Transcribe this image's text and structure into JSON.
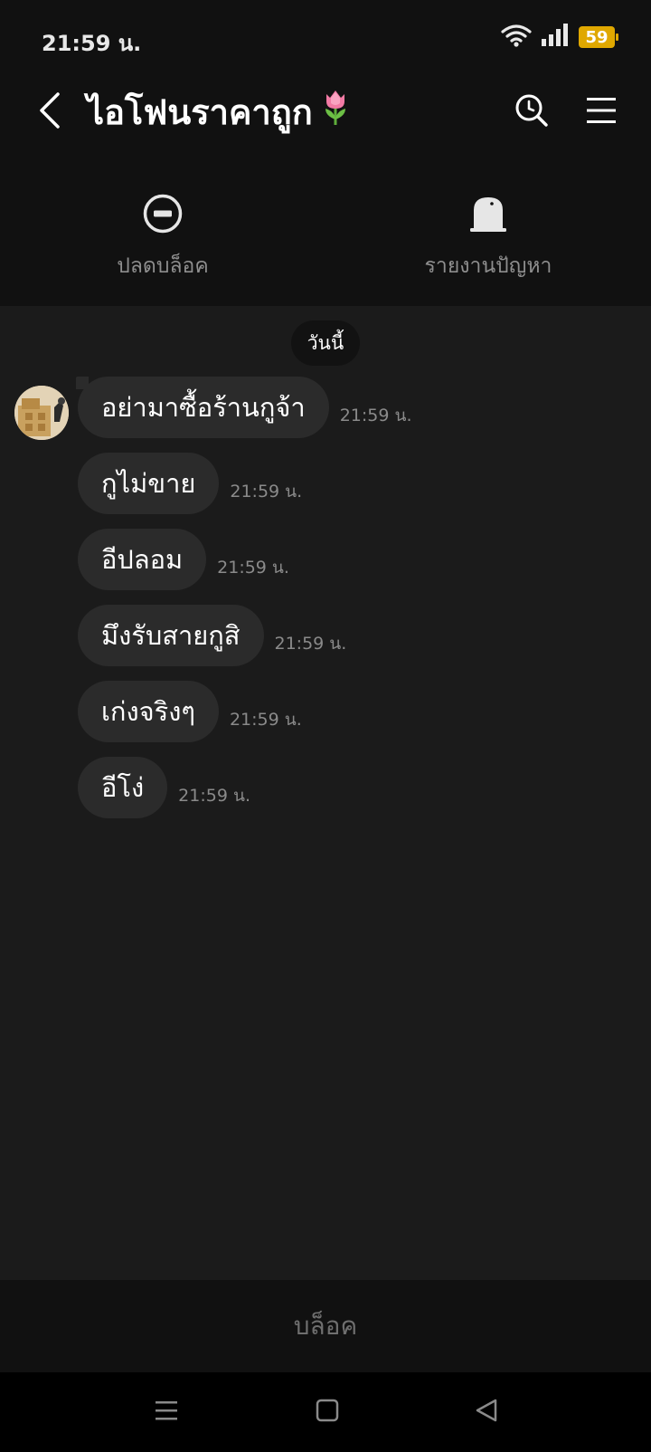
{
  "status_bar": {
    "time": "21:59 น.",
    "battery": "59",
    "icons": [
      "wifi-icon",
      "signal-icon",
      "battery-icon"
    ],
    "battery_color": "#e0a800"
  },
  "header": {
    "title": "ไอโฟนราคาถูก",
    "title_emoji": "tulip-emoji",
    "icons": [
      "back-arrow-icon",
      "search-icon",
      "menu-icon"
    ]
  },
  "actions": {
    "unblock_label": "ปลดบล็อค",
    "report_label": "รายงานปัญหา"
  },
  "chat": {
    "date_label": "วันนี้",
    "messages": [
      {
        "text": "อย่ามาซื้อร้านกูจ้า",
        "time": "21:59 น."
      },
      {
        "text": "กูไม่ขาย",
        "time": "21:59 น."
      },
      {
        "text": "อีปลอม",
        "time": "21:59 น."
      },
      {
        "text": "มึงรับสายกูสิ",
        "time": "21:59 น."
      },
      {
        "text": "เก่งจริงๆ",
        "time": "21:59 น."
      },
      {
        "text": "อีโง่",
        "time": "21:59 น."
      }
    ]
  },
  "footer": {
    "block_label": "บล็อค"
  },
  "colors": {
    "background": "#1b1b1b",
    "header_bg": "#111111",
    "bubble_bg": "#2b2b2b",
    "muted_text": "#8a8a8a"
  }
}
